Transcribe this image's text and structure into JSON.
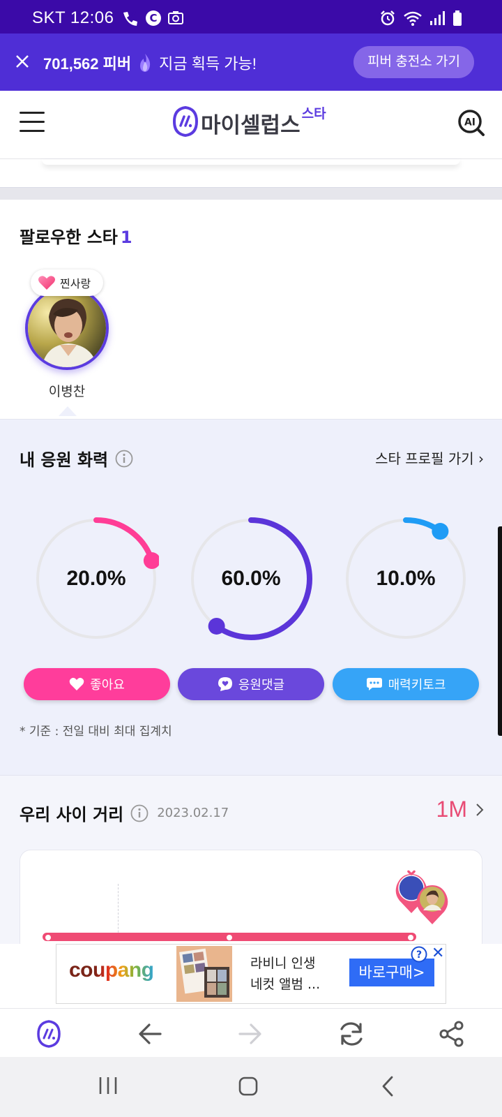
{
  "status_bar": {
    "carrier_time": "SKT 12:06"
  },
  "promo": {
    "amount": "701,562 피버",
    "message": "지금 획득 가능!",
    "button": "피버 충전소 가기"
  },
  "header": {
    "logo_text": "마이셀럽스",
    "logo_sup": "스타",
    "ai_label": "AI"
  },
  "following": {
    "title": "팔로우한 스타",
    "count": "1",
    "stars": [
      {
        "badge": "찐사랑",
        "name": "이병찬"
      }
    ]
  },
  "support": {
    "title": "내 응원 화력",
    "profile_link": "스타 프로필 가기",
    "gauges": [
      {
        "label": "20.0%",
        "value": 0.2,
        "color": "#ff3d96"
      },
      {
        "label": "60.0%",
        "value": 0.6,
        "color": "#5b35d9"
      },
      {
        "label": "10.0%",
        "value": 0.1,
        "color": "#1f9cf5"
      }
    ],
    "buttons": [
      {
        "label": "좋아요",
        "color": "#ff3d9b"
      },
      {
        "label": "응원댓글",
        "color": "#6a48dc"
      },
      {
        "label": "매력키토크",
        "color": "#36a4f7"
      }
    ],
    "note": "* 기준 : 전일 대비 최대 집계치"
  },
  "distance": {
    "title": "우리 사이 거리",
    "date": "2023.02.17",
    "range": "1M"
  },
  "ad": {
    "brand": "coupang",
    "line1": "라비니 인생",
    "line2": "네컷 앨범 ...",
    "cta": "바로구매>",
    "help": "?",
    "close": "✕"
  }
}
